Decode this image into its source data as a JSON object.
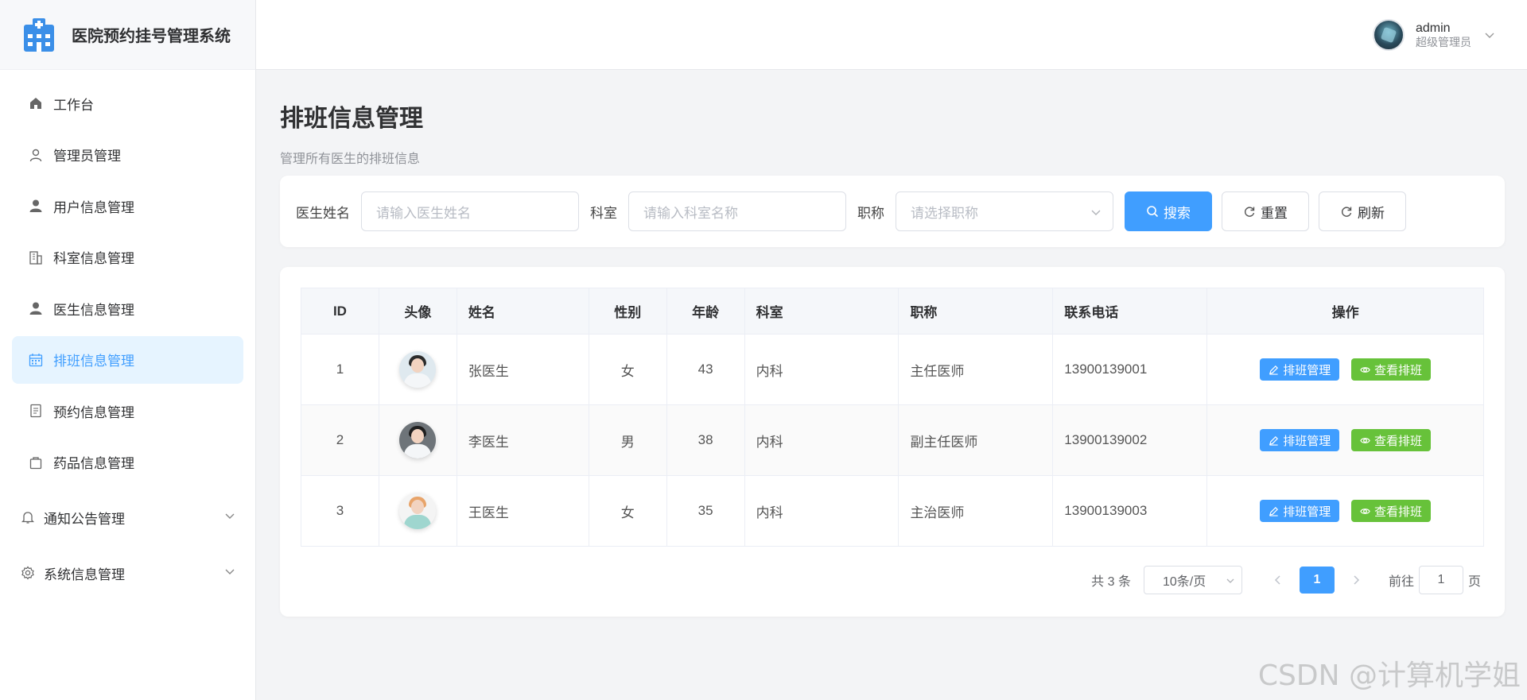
{
  "app": {
    "title": "医院预约挂号管理系统"
  },
  "sidebar": {
    "items": [
      {
        "label": "工作台",
        "icon": "home-icon"
      },
      {
        "label": "管理员管理",
        "icon": "user-outline-icon"
      },
      {
        "label": "用户信息管理",
        "icon": "user-filled-icon"
      },
      {
        "label": "科室信息管理",
        "icon": "building-icon"
      },
      {
        "label": "医生信息管理",
        "icon": "user-filled-icon"
      },
      {
        "label": "排班信息管理",
        "icon": "calendar-icon",
        "active": true
      },
      {
        "label": "预约信息管理",
        "icon": "document-icon"
      },
      {
        "label": "药品信息管理",
        "icon": "bag-icon"
      }
    ],
    "groups": [
      {
        "label": "通知公告管理",
        "icon": "bell-icon"
      },
      {
        "label": "系统信息管理",
        "icon": "gear-icon"
      }
    ]
  },
  "header": {
    "username": "admin",
    "role": "超级管理员"
  },
  "page": {
    "title": "排班信息管理",
    "subtitle": "管理所有医生的排班信息"
  },
  "search": {
    "doctor_label": "医生姓名",
    "doctor_placeholder": "请输入医生姓名",
    "dept_label": "科室",
    "dept_placeholder": "请输入科室名称",
    "title_label": "职称",
    "title_placeholder": "请选择职称",
    "search_btn": "搜索",
    "reset_btn": "重置",
    "refresh_btn": "刷新"
  },
  "table": {
    "headers": [
      "ID",
      "头像",
      "姓名",
      "性别",
      "年龄",
      "科室",
      "职称",
      "联系电话",
      "操作"
    ],
    "rows": [
      {
        "id": "1",
        "name": "张医生",
        "gender": "女",
        "age": "43",
        "dept": "内科",
        "title": "主任医师",
        "phone": "13900139001"
      },
      {
        "id": "2",
        "name": "李医生",
        "gender": "男",
        "age": "38",
        "dept": "内科",
        "title": "副主任医师",
        "phone": "13900139002"
      },
      {
        "id": "3",
        "name": "王医生",
        "gender": "女",
        "age": "35",
        "dept": "内科",
        "title": "主治医师",
        "phone": "13900139003"
      }
    ],
    "action_schedule": "排班管理",
    "action_view": "查看排班"
  },
  "pagination": {
    "total_text": "共 3 条",
    "page_size": "10条/页",
    "current_page": "1",
    "goto_prefix": "前往",
    "goto_value": "1",
    "goto_suffix": "页"
  },
  "watermark": "CSDN @计算机学姐",
  "colors": {
    "primary": "#409eff",
    "success": "#67c23a",
    "active_bg": "#e6f4ff"
  }
}
